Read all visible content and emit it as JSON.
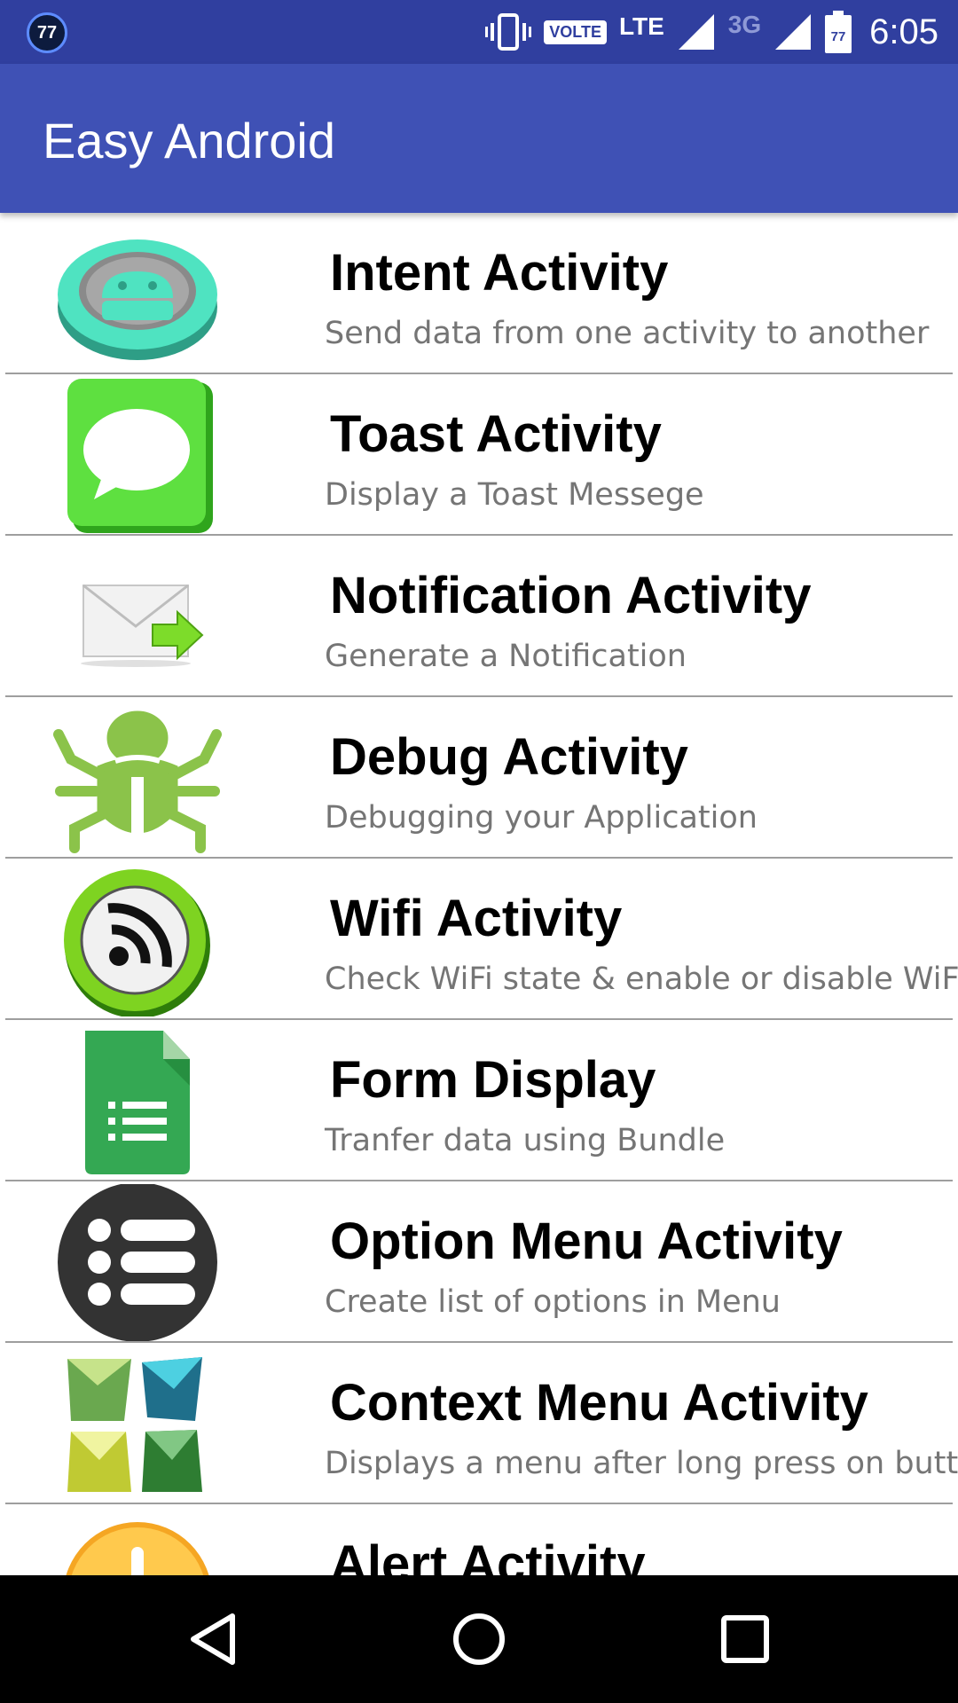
{
  "status_bar": {
    "notification_badge": "77",
    "volte_label": "VOLTE",
    "lte_label": "LTE",
    "network_3g_label": "3G",
    "battery_level": "77",
    "time": "6:05"
  },
  "app_bar": {
    "title": "Easy Android"
  },
  "items": [
    {
      "title": "Intent Activity",
      "subtitle": "Send data from one activity to another",
      "icon": "android-badge-icon"
    },
    {
      "title": "Toast Activity",
      "subtitle": "Display a Toast Messege",
      "icon": "message-bubble-icon"
    },
    {
      "title": "Notification Activity",
      "subtitle": "Generate a Notification",
      "icon": "envelope-arrow-icon"
    },
    {
      "title": "Debug Activity",
      "subtitle": "Debugging your Application",
      "icon": "bug-icon"
    },
    {
      "title": "Wifi Activity",
      "subtitle": "Check WiFi state & enable or disable WiFi",
      "icon": "wifi-icon"
    },
    {
      "title": "Form Display",
      "subtitle": "Tranfer data using Bundle",
      "icon": "form-sheet-icon"
    },
    {
      "title": "Option Menu Activity",
      "subtitle": "Create list of options in Menu",
      "icon": "menu-list-icon"
    },
    {
      "title": "Context Menu Activity",
      "subtitle": "Displays a menu after long press on button",
      "icon": "tiles-icon"
    },
    {
      "title": "Alert Activity",
      "subtitle": "",
      "icon": "alert-icon"
    }
  ],
  "colors": {
    "status_bar": "#303f9f",
    "app_bar": "#3f51b5",
    "title_text": "#000000",
    "subtitle_text": "#757575",
    "divider": "#9e9e9e",
    "nav_bar": "#000000"
  }
}
